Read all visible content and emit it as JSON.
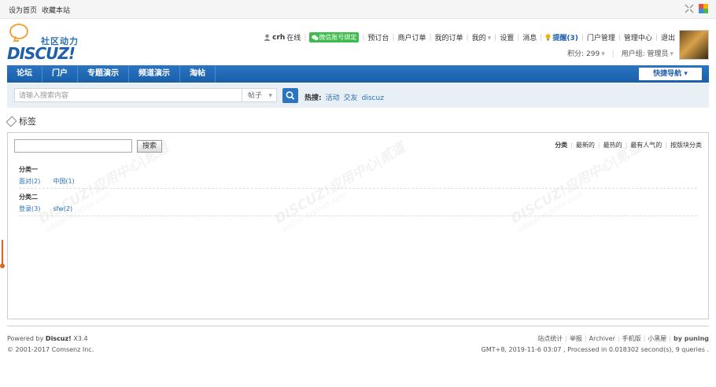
{
  "topbar": {
    "set_home": "设为首页",
    "bookmark": "收藏本站"
  },
  "logo": {
    "tagline": "社区动力",
    "brand": "DISCUZ!"
  },
  "user_nav": {
    "username": "crh",
    "status": "在线",
    "wechat_bind": "微信账号绑定",
    "items": [
      "预订台",
      "商户订单",
      "我的订单",
      "我的",
      "设置",
      "消息"
    ],
    "remind": "提醒(3)",
    "items2": [
      "门户管理",
      "管理中心",
      "退出"
    ],
    "points": "积分: 299",
    "usergroup": "用户组: 管理员"
  },
  "nav": {
    "items": [
      "论坛",
      "门户",
      "专题演示",
      "频道演示",
      "淘帖"
    ],
    "quick_nav": "快捷导航"
  },
  "search": {
    "placeholder": "请输入搜索内容",
    "type": "帖子",
    "hot_label": "热搜:",
    "hot_words": [
      "活动",
      "交友",
      "discuz"
    ]
  },
  "page": {
    "title": "标签"
  },
  "tags": {
    "search_button": "搜索",
    "sorts": [
      "分类",
      "最新的",
      "最热的",
      "最有人气的",
      "按版块分类"
    ],
    "categories": [
      {
        "name": "分类一",
        "tags": [
          "面对(2)",
          "中国(1)"
        ]
      },
      {
        "name": "分类二",
        "tags": [
          "登录(3)",
          "sfw(2)"
        ]
      }
    ]
  },
  "watermark": {
    "text": "DISCUZ!应用中心|贰道",
    "url": "addon.dismall.com"
  },
  "footer": {
    "powered_prefix": "Powered by",
    "powered_brand": "Discuz!",
    "version": "X3.4",
    "copyright": "© 2001-2017 Comsenz Inc.",
    "links": [
      "站点统计",
      "举报",
      "Archiver",
      "手机版",
      "小黑屋"
    ],
    "by": "by puning",
    "stats": "GMT+8, 2019-11-6 03:07 , Processed in 0.018302 second(s), 9 queries ."
  }
}
